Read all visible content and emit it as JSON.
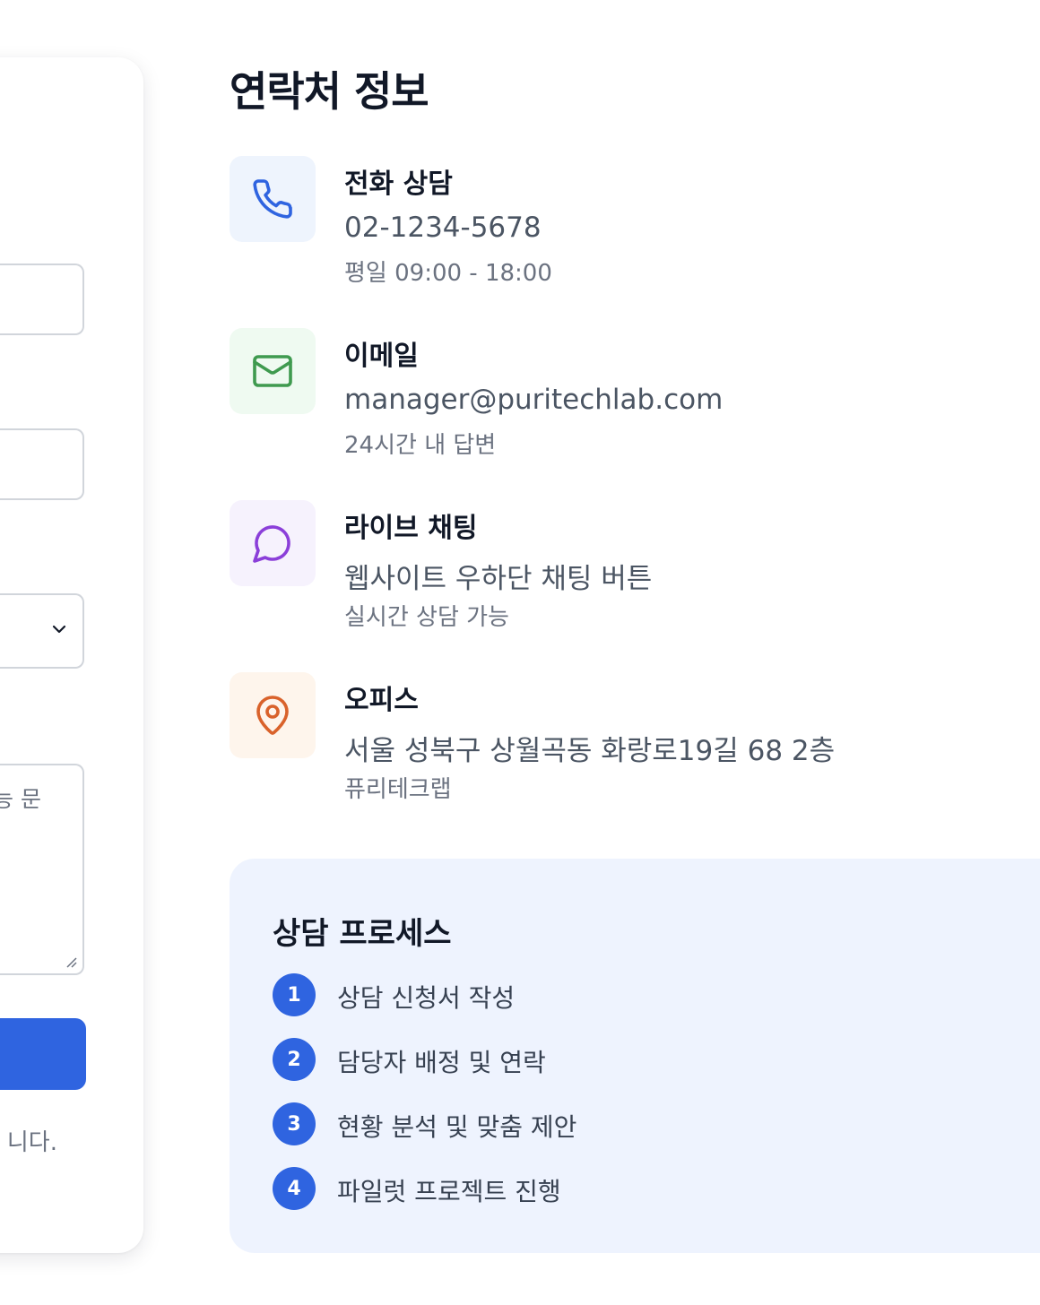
{
  "form": {
    "textarea_placeholder_tail": "능 문",
    "notice_tail": "니다."
  },
  "contact": {
    "title": "연락처 정보",
    "items": [
      {
        "icon": "phone-icon",
        "title": "전화 상담",
        "main": "02-1234-5678",
        "sub": "평일 09:00 - 18:00",
        "color": "#2f64e0",
        "bg": "#eef4fd"
      },
      {
        "icon": "mail-icon",
        "title": "이메일",
        "main": "manager@puritechlab.com",
        "sub": "24시간 내 답변",
        "color": "#3f9a4f",
        "bg": "#effaf1"
      },
      {
        "icon": "chat-icon",
        "title": "라이브 채팅",
        "main": "웹사이트 우하단 채팅 버튼",
        "sub": "실시간 상담 가능",
        "color": "#8b3fd9",
        "bg": "#f6f2fd"
      },
      {
        "icon": "map-pin-icon",
        "title": "오피스",
        "main": "서울 성북구 상월곡동 화랑로19길 68 2층",
        "sub": "퓨리테크랩",
        "color": "#d9622b",
        "bg": "#fef5ec"
      }
    ]
  },
  "process": {
    "title": "상담 프로세스",
    "steps": [
      {
        "num": "1",
        "text": "상담 신청서 작성"
      },
      {
        "num": "2",
        "text": "담당자 배정 및 연락"
      },
      {
        "num": "3",
        "text": "현황 분석 및 맞춤 제안"
      },
      {
        "num": "4",
        "text": "파일럿 프로젝트 진행"
      }
    ]
  },
  "colors": {
    "accent": "#2f64e0",
    "process_bg": "#eef3fe"
  }
}
